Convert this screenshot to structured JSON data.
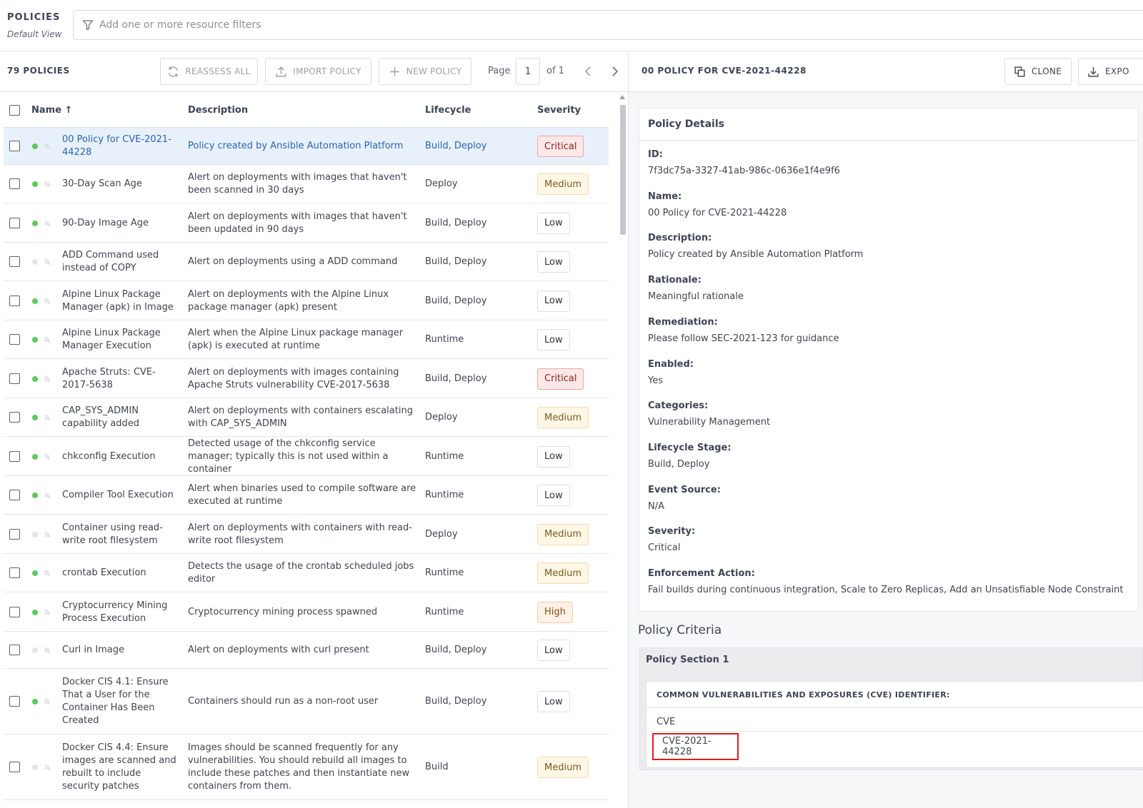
{
  "header": {
    "title": "POLICIES",
    "subtitle": "Default View",
    "filter_placeholder": "Add one or more resource filters"
  },
  "toolbar": {
    "count_label": "79 POLICIES",
    "reassess_label": "REASSESS ALL",
    "import_label": "IMPORT POLICY",
    "new_label": "NEW POLICY",
    "page_label": "Page",
    "page_value": "1",
    "of_label": "of 1"
  },
  "table": {
    "headers": {
      "name": "Name ↑",
      "description": "Description",
      "lifecycle": "Lifecycle",
      "severity": "Severity"
    },
    "rows": [
      {
        "name": "00 Policy for CVE-2021-44228",
        "description": "Policy created by Ansible Automation Platform",
        "lifecycle": "Build, Deploy",
        "severity": "Critical",
        "enabled": true,
        "selected": true
      },
      {
        "name": "30-Day Scan Age",
        "description": "Alert on deployments with images that haven't been scanned in 30 days",
        "lifecycle": "Deploy",
        "severity": "Medium",
        "enabled": true
      },
      {
        "name": "90-Day Image Age",
        "description": "Alert on deployments with images that haven't been updated in 90 days",
        "lifecycle": "Build, Deploy",
        "severity": "Low",
        "enabled": true
      },
      {
        "name": "ADD Command used instead of COPY",
        "description": "Alert on deployments using a ADD command",
        "lifecycle": "Build, Deploy",
        "severity": "Low",
        "enabled": false
      },
      {
        "name": "Alpine Linux Package Manager (apk) in Image",
        "description": "Alert on deployments with the Alpine Linux package manager (apk) present",
        "lifecycle": "Build, Deploy",
        "severity": "Low",
        "enabled": true
      },
      {
        "name": "Alpine Linux Package Manager Execution",
        "description": "Alert when the Alpine Linux package manager (apk) is executed at runtime",
        "lifecycle": "Runtime",
        "severity": "Low",
        "enabled": true
      },
      {
        "name": "Apache Struts: CVE-2017-5638",
        "description": "Alert on deployments with images containing Apache Struts vulnerability CVE-2017-5638",
        "lifecycle": "Build, Deploy",
        "severity": "Critical",
        "enabled": true
      },
      {
        "name": "CAP_SYS_ADMIN capability added",
        "description": "Alert on deployments with containers escalating with CAP_SYS_ADMIN",
        "lifecycle": "Deploy",
        "severity": "Medium",
        "enabled": true
      },
      {
        "name": "chkconfig Execution",
        "description": "Detected usage of the chkconfig service manager; typically this is not used within a container",
        "lifecycle": "Runtime",
        "severity": "Low",
        "enabled": true
      },
      {
        "name": "Compiler Tool Execution",
        "description": "Alert when binaries used to compile software are executed at runtime",
        "lifecycle": "Runtime",
        "severity": "Low",
        "enabled": true
      },
      {
        "name": "Container using read-write root filesystem",
        "description": "Alert on deployments with containers with read-write root filesystem",
        "lifecycle": "Deploy",
        "severity": "Medium",
        "enabled": false
      },
      {
        "name": "crontab Execution",
        "description": "Detects the usage of the crontab scheduled jobs editor",
        "lifecycle": "Runtime",
        "severity": "Medium",
        "enabled": true
      },
      {
        "name": "Cryptocurrency Mining Process Execution",
        "description": "Cryptocurrency mining process spawned",
        "lifecycle": "Runtime",
        "severity": "High",
        "enabled": true
      },
      {
        "name": "Curl in Image",
        "description": "Alert on deployments with curl present",
        "lifecycle": "Build, Deploy",
        "severity": "Low",
        "enabled": false
      },
      {
        "name": "Docker CIS 4.1: Ensure That a User for the Container Has Been Created",
        "description": "Containers should run as a non-root user",
        "lifecycle": "Build, Deploy",
        "severity": "Low",
        "enabled": true
      },
      {
        "name": "Docker CIS 4.4: Ensure images are scanned and rebuilt to include security patches",
        "description": "Images should be scanned frequently for any vulnerabilities. You should rebuild all images to include these patches and then instantiate new containers from them.",
        "lifecycle": "Build",
        "severity": "Medium",
        "enabled": false
      }
    ]
  },
  "details": {
    "header_title": "00 POLICY FOR CVE-2021-44228",
    "clone_label": "CLONE",
    "export_label": "EXPO",
    "card_title": "Policy Details",
    "fields": [
      {
        "label": "ID:",
        "value": "7f3dc75a-3327-41ab-986c-0636e1f4e9f6"
      },
      {
        "label": "Name:",
        "value": "00 Policy for CVE-2021-44228"
      },
      {
        "label": "Description:",
        "value": "Policy created by Ansible Automation Platform"
      },
      {
        "label": "Rationale:",
        "value": "Meaningful rationale"
      },
      {
        "label": "Remediation:",
        "value": "Please follow SEC-2021-123 for guidance"
      },
      {
        "label": "Enabled:",
        "value": "Yes"
      },
      {
        "label": "Categories:",
        "value": "Vulnerability Management"
      },
      {
        "label": "Lifecycle Stage:",
        "value": "Build, Deploy"
      },
      {
        "label": "Event Source:",
        "value": "N/A"
      },
      {
        "label": "Severity:",
        "value": "Critical"
      },
      {
        "label": "Enforcement Action:",
        "value": "Fail builds during continuous integration, Scale to Zero Replicas, Add an Unsatisfiable Node Constraint"
      }
    ]
  },
  "criteria": {
    "title": "Policy Criteria",
    "section_title": "Policy Section 1",
    "group_title": "COMMON VULNERABILITIES AND EXPOSURES (CVE) IDENTIFIER:",
    "field_label": "CVE",
    "field_value": "CVE-2021-44228"
  },
  "colors": {
    "accent_link": "#2b63b0",
    "selected_row": "#e8f1fb",
    "enabled_dot": "#5ec95e",
    "highlight_border": "#e01b1b"
  },
  "icons": [
    "filter-icon",
    "sync-icon",
    "upload-icon",
    "plus-icon",
    "chevron-left-icon",
    "chevron-right-icon",
    "copy-icon",
    "download-icon",
    "bell-slash-icon"
  ]
}
